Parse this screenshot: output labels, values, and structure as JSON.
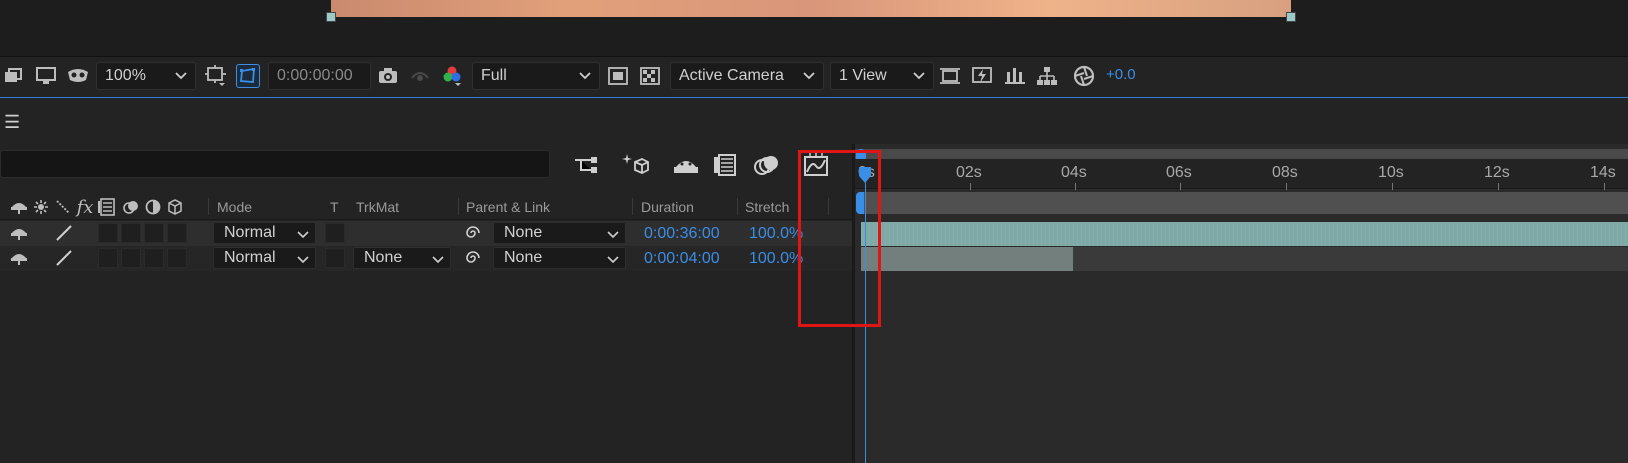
{
  "viewer_toolbar": {
    "zoom": "100%",
    "timecode": "0:00:00:00",
    "resolution": "Full",
    "camera": "Active Camera",
    "views": "1 View",
    "exposure": "+0.0"
  },
  "columns": {
    "mode": "Mode",
    "t": "T",
    "trkmat": "TrkMat",
    "parent": "Parent & Link",
    "duration": "Duration",
    "stretch": "Stretch"
  },
  "layers": [
    {
      "mode": "Normal",
      "trkmat": "",
      "parent": "None",
      "duration": "0:00:36:00",
      "stretch": "100.0%"
    },
    {
      "mode": "Normal",
      "trkmat": "None",
      "parent": "None",
      "duration": "0:00:04:00",
      "stretch": "100.0%"
    }
  ],
  "timeline": {
    "ticks": [
      "0s",
      "02s",
      "04s",
      "06s",
      "08s",
      "10s",
      "12s",
      "14s"
    ],
    "layer2_duration_seconds": 4
  },
  "colors": {
    "accent": "#3a8ee6",
    "highlight": "#e01515",
    "layer1_bar": "#7fa9a6",
    "layer2_bar": "#727f7d"
  }
}
